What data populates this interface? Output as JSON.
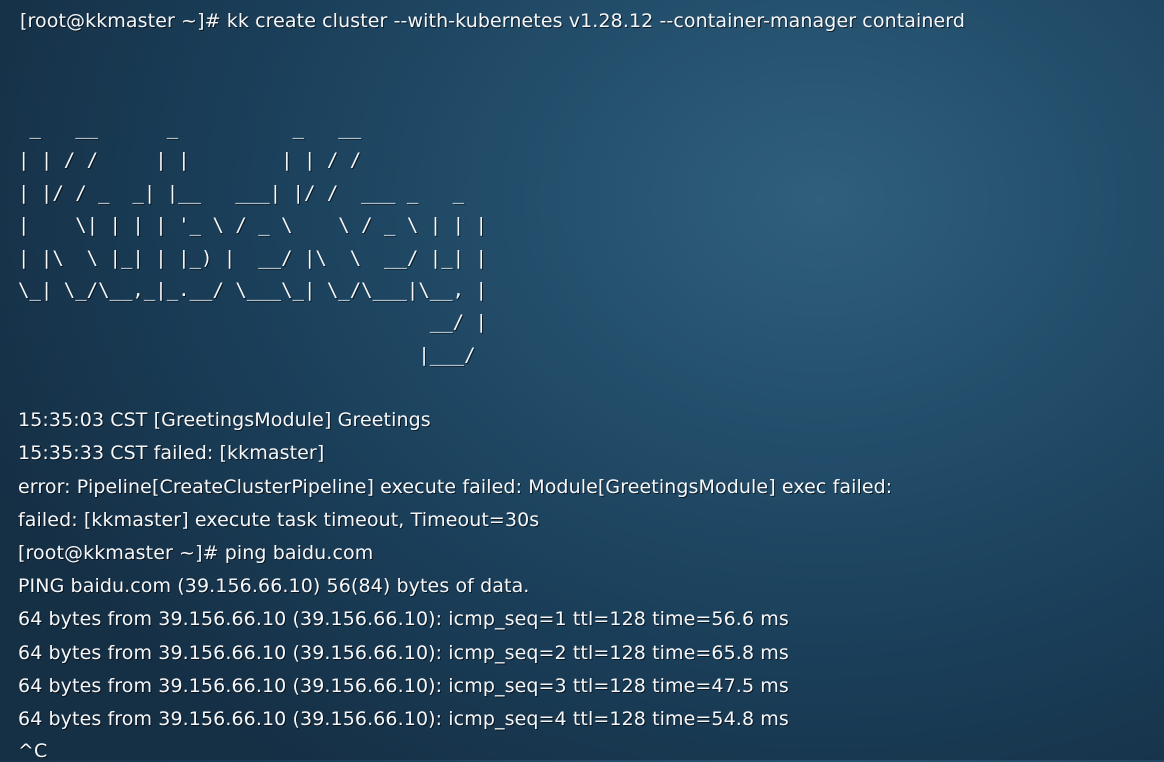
{
  "terminal": {
    "command_line": "[root@kkmaster ~]# kk create cluster --with-kubernetes v1.28.12 --container-manager containerd",
    "ascii_banner": [
      " _   __      _          _   __",
      "| | / /     | |        | | / /",
      "| |/ / _  _| |__   ___| |/ /  ___ _   _",
      "|    \\| | | | '_ \\ / _ \\    \\ / _ \\ | | |",
      "| |\\  \\ |_| | |_) |  __/ |\\  \\  __/ |_| |",
      "\\_| \\_/\\__,_|_.__/ \\___\\_| \\_/\\___|\\__, |",
      "                                    __/ |",
      "                                   |___/"
    ],
    "output_lines": [
      "15:35:03 CST [GreetingsModule] Greetings",
      "15:35:33 CST failed: [kkmaster]",
      "error: Pipeline[CreateClusterPipeline] execute failed: Module[GreetingsModule] exec failed:",
      "failed: [kkmaster] execute task timeout, Timeout=30s",
      "[root@kkmaster ~]# ping baidu.com",
      "PING baidu.com (39.156.66.10) 56(84) bytes of data.",
      "64 bytes from 39.156.66.10 (39.156.66.10): icmp_seq=1 ttl=128 time=56.6 ms",
      "64 bytes from 39.156.66.10 (39.156.66.10): icmp_seq=2 ttl=128 time=65.8 ms",
      "64 bytes from 39.156.66.10 (39.156.66.10): icmp_seq=3 ttl=128 time=47.5 ms",
      "64 bytes from 39.156.66.10 (39.156.66.10): icmp_seq=4 ttl=128 time=54.8 ms",
      "^C"
    ]
  }
}
